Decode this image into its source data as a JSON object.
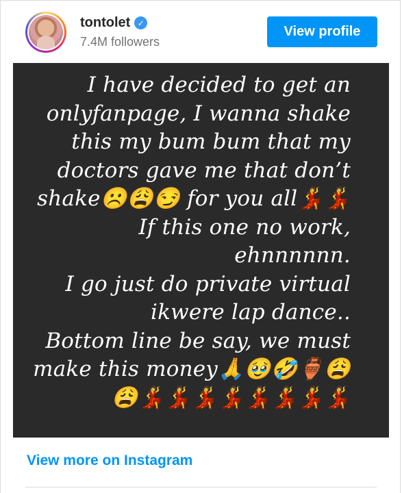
{
  "profile": {
    "username": "tontolet",
    "verified_icon": "verified-badge-icon",
    "followers": "7.4M followers",
    "view_profile_label": "View profile"
  },
  "post": {
    "text": "I have decided to get an\nonlyfanpage, I wanna shake\nthis my bum bum that my\ndoctors gave me that don’t\nshake☹️😩😏  for you all💃💃\nIf this one no work,\nehnnnnnn.\nI go just do private virtual\nikwere lap dance..\nBottom line be say, we must\nmake this money🙏🥹🤣🏺😩\n😩💃💃💃💃💃💃💃💃"
  },
  "footer": {
    "link_label": "View more on Instagram"
  },
  "colors": {
    "accent": "#0095f6",
    "post_background": "#2a2a2a"
  }
}
